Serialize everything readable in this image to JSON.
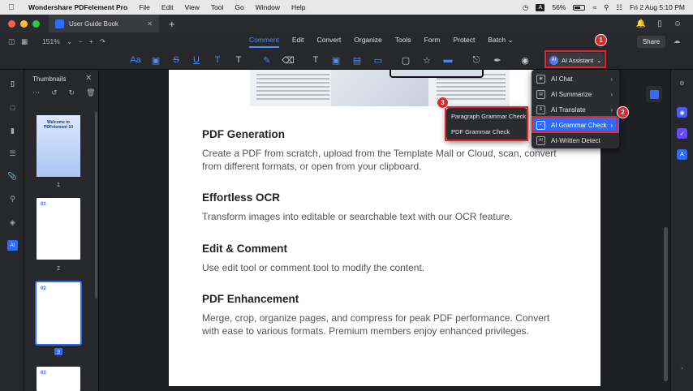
{
  "menubar": {
    "app": "Wondershare PDFelement Pro",
    "items": [
      "File",
      "Edit",
      "View",
      "Tool",
      "Go",
      "Window",
      "Help"
    ],
    "battery": "56%",
    "input_source": "A",
    "datetime": "Fri 2 Aug  5:10 PM"
  },
  "tab": {
    "title": "User Guide Book"
  },
  "zoom": "151%",
  "nav_tabs": [
    "Comment",
    "Edit",
    "Convert",
    "Organize",
    "Tools",
    "Form",
    "Protect",
    "Batch"
  ],
  "share_label": "Share",
  "ai_assistant": {
    "label": "AI Assistant",
    "icon_text": "AI"
  },
  "ai_menu": {
    "items": [
      {
        "label": "AI Chat",
        "icon": "ai-chat-icon"
      },
      {
        "label": "AI Summarize",
        "icon": "summarize-icon"
      },
      {
        "label": "AI Translate",
        "icon": "translate-icon"
      },
      {
        "label": "AI Grammar Check",
        "icon": "grammar-check-icon"
      },
      {
        "label": "AI-Written Detect",
        "icon": "ai-detect-icon"
      }
    ],
    "submenu": [
      "Paragraph Grammar Check",
      "PDF Grammar Check"
    ]
  },
  "badges": [
    "1",
    "2",
    "3"
  ],
  "thumbnails": {
    "title": "Thumbnails",
    "pages": [
      "1",
      "2",
      "3"
    ],
    "page1_text": "Welcome to PDFelement 10",
    "page2_heading": "01",
    "page3_heading": "02",
    "page4_heading": "03"
  },
  "left_rail_ai_label": "AI",
  "document": {
    "sections": [
      {
        "title": "PDF Generation",
        "body": "Create a PDF from scratch, upload from the Template Mall or Cloud, scan, convert from different formats, or open from your clipboard."
      },
      {
        "title": "Effortless OCR",
        "body": "Transform images into editable or searchable text with our OCR feature."
      },
      {
        "title": "Edit & Comment",
        "body": "Use edit tool or comment tool to modify the content."
      },
      {
        "title": "PDF Enhancement",
        "body": "Merge, crop, organize pages, and compress for peak PDF performance. Convert with ease to various formats. Premium members enjoy enhanced privileges."
      }
    ]
  },
  "colors": {
    "accent": "#2f6bff",
    "highlight": "#e0262a"
  }
}
